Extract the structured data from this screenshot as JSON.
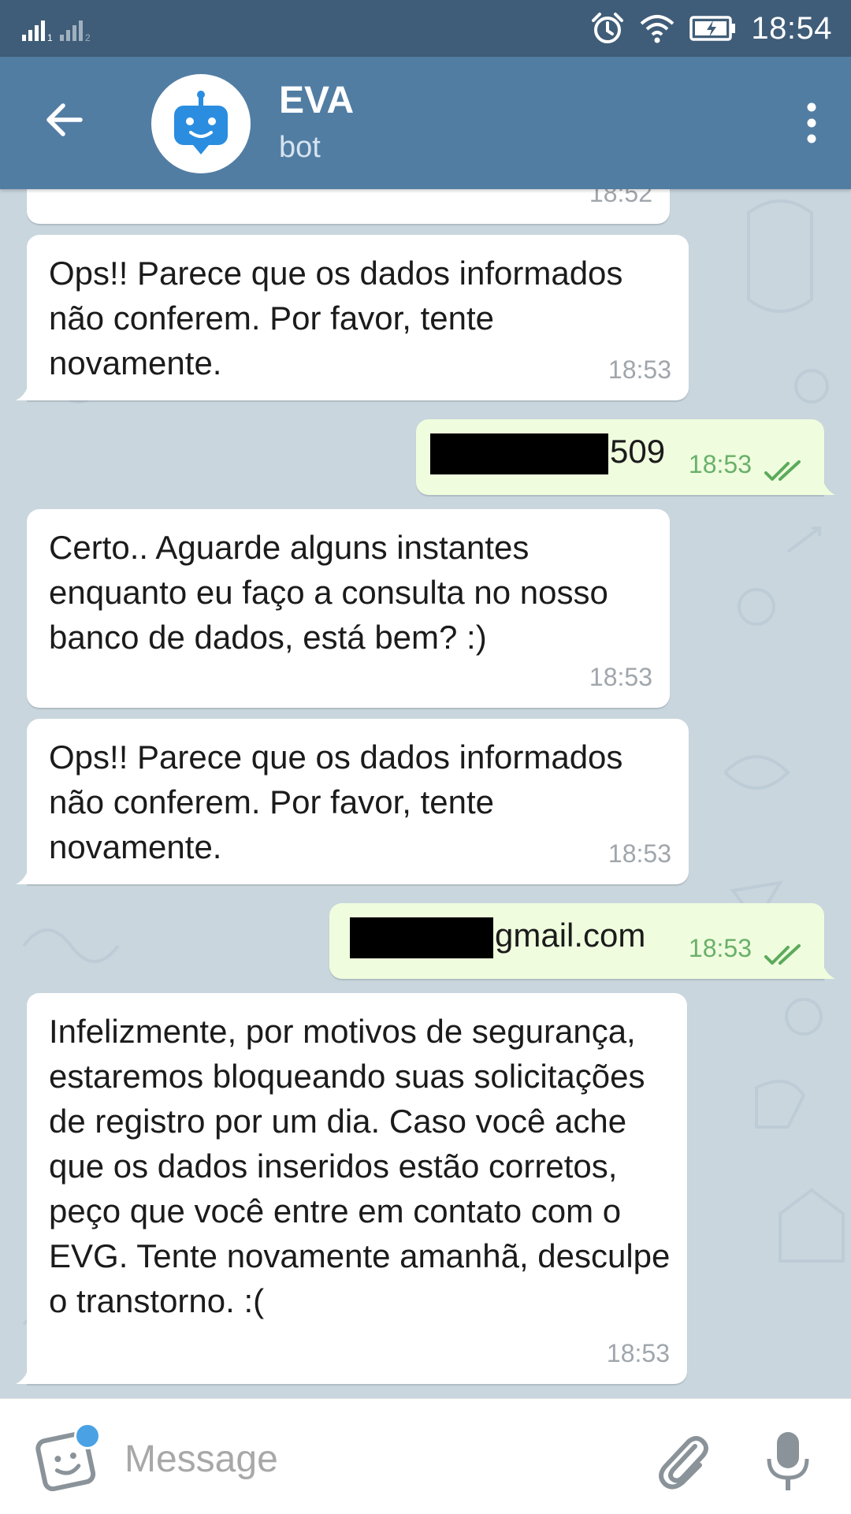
{
  "status_bar": {
    "time": "18:54"
  },
  "header": {
    "title": "EVA",
    "subtitle": "bot"
  },
  "messages": [
    {
      "direction": "in",
      "text": "",
      "time": "18:52"
    },
    {
      "direction": "in",
      "text": "Ops!! Parece que os dados informados não conferem. Por favor, tente novamente.",
      "time": "18:53"
    },
    {
      "direction": "out",
      "text": "509",
      "time": "18:53",
      "redacted_prefix": true,
      "status": "read"
    },
    {
      "direction": "in",
      "text": "Certo.. Aguarde alguns instantes enquanto eu faço a consulta no nosso banco de dados, está bem? :)",
      "time": "18:53"
    },
    {
      "direction": "in",
      "text": "Ops!! Parece que os dados informados não conferem. Por favor, tente novamente.",
      "time": "18:53"
    },
    {
      "direction": "out",
      "text": "gmail.com",
      "time": "18:53",
      "redacted_prefix": true,
      "status": "read"
    },
    {
      "direction": "in",
      "text": "Infelizmente, por motivos de segurança, estaremos bloqueando suas solicitações de registro por um dia. Caso você ache que os dados inseridos estão corretos, peço que você entre em contato com o EVG. Tente novamente amanhã, desculpe o transtorno. :(",
      "time": "18:53"
    }
  ],
  "input": {
    "placeholder": "Message",
    "value": ""
  },
  "icons": {
    "back": "arrow-left-icon",
    "menu": "more-vert-icon",
    "avatar": "robot-icon",
    "emoji": "sticker-icon",
    "attach": "paperclip-icon",
    "mic": "microphone-icon",
    "read_status": "double-check-icon"
  },
  "colors": {
    "header": "#527da3",
    "status_bar": "#3f5d78",
    "chat_bg": "#c9d6de",
    "outgoing_bubble": "#effdde",
    "incoming_bubble": "#ffffff",
    "outgoing_time": "#6ab06a",
    "accent": "#4aa2e4"
  }
}
